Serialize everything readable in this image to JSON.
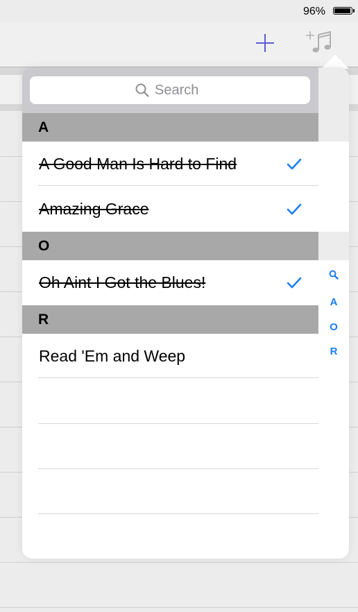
{
  "status_bar": {
    "battery_percent": "96%",
    "battery_level": 0.96
  },
  "nav": {
    "add_icon": "plus-icon",
    "add_music_icon": "add-music-icon"
  },
  "colors": {
    "accent": "#1a7ef5",
    "section_header": "#a8a8a8",
    "search_bar": "#c9c9ce"
  },
  "popover": {
    "search": {
      "placeholder": "Search"
    },
    "sections": [
      {
        "title": "A",
        "items": [
          {
            "label": "A Good Man Is Hard to Find",
            "done": true
          },
          {
            "label": "Amazing Grace",
            "done": true
          }
        ]
      },
      {
        "title": "O",
        "items": [
          {
            "label": "Oh Aint I Got the Blues!",
            "done": true
          }
        ]
      },
      {
        "title": "R",
        "items": [
          {
            "label": "Read 'Em and Weep",
            "done": false
          }
        ]
      }
    ],
    "index": [
      "A",
      "O",
      "R"
    ]
  }
}
